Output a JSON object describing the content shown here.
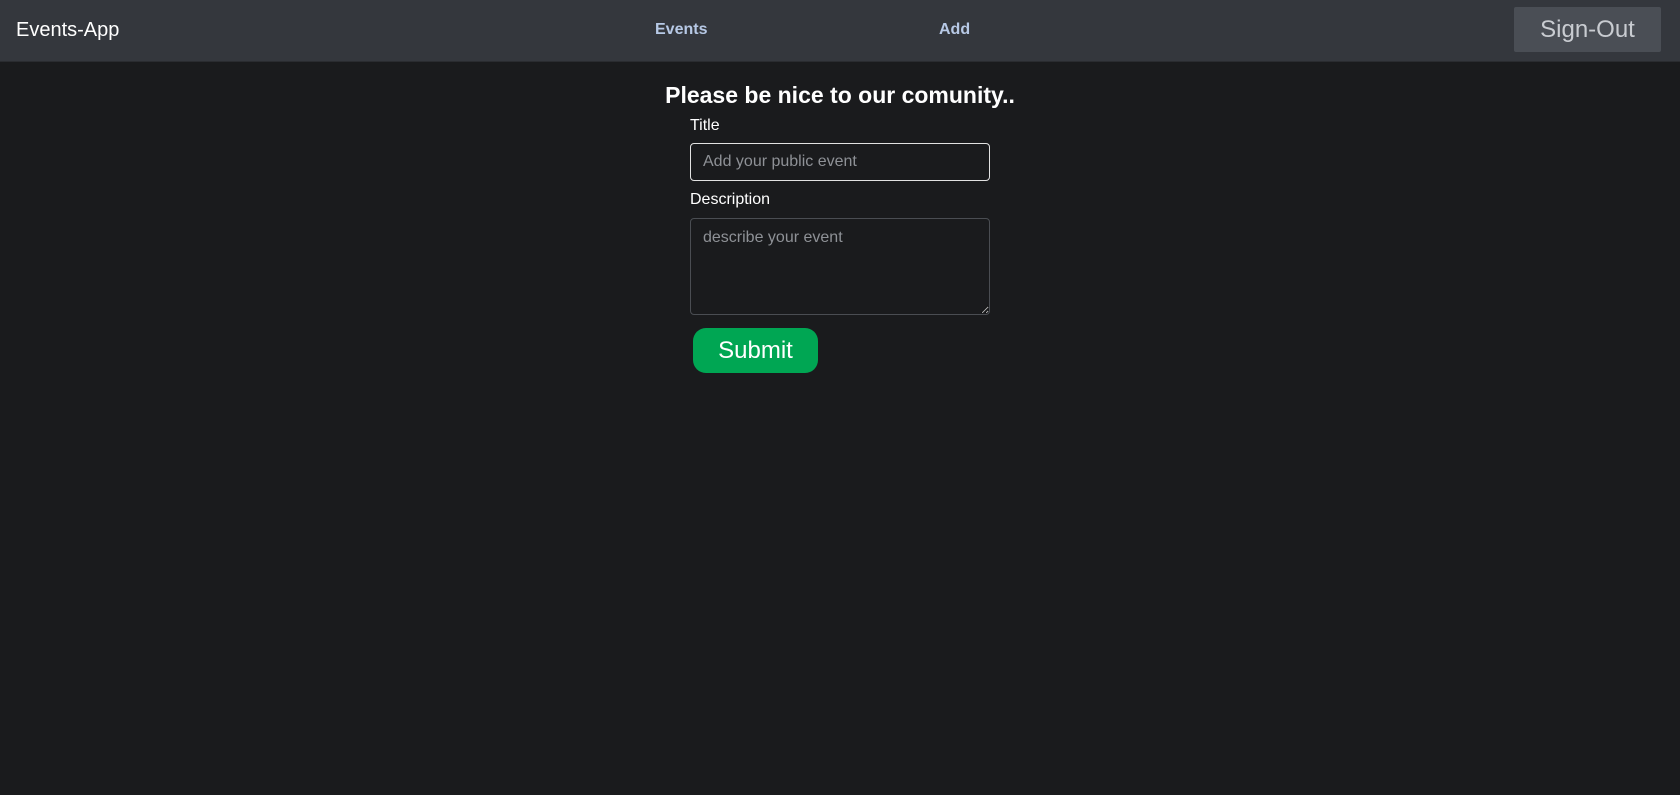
{
  "navbar": {
    "brand": "Events-App",
    "links": [
      {
        "label": "Events"
      },
      {
        "label": "Add"
      }
    ],
    "signout_label": "Sign-Out"
  },
  "form": {
    "heading": "Please be nice to our comunity..",
    "title_label": "Title",
    "title_value": "",
    "title_placeholder": "Add your public event",
    "description_label": "Description",
    "description_value": "",
    "description_placeholder": "describe your event",
    "submit_label": "Submit"
  },
  "colors": {
    "background": "#1a1b1d",
    "navbar": "#34373d",
    "nav_link": "#b7c9e6",
    "submit": "#00a653",
    "signout_bg": "#4a4e55"
  }
}
